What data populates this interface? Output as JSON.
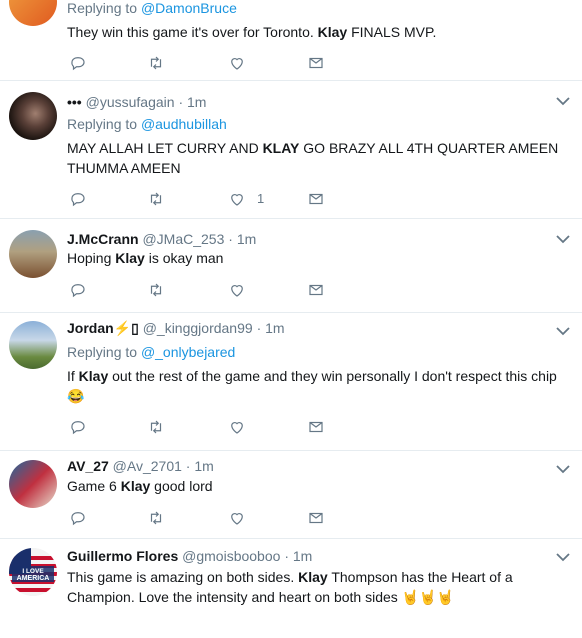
{
  "tweets": [
    {
      "reply_prefix": "Replying to ",
      "reply_handle": "@DamonBruce",
      "text_before": "They win this game it's over for Toronto. ",
      "bold": "Klay",
      "text_after": " FINALS MVP."
    },
    {
      "name": "•••",
      "handle": "@yussufagain",
      "dot": "·",
      "time": "1m",
      "reply_prefix": "Replying to ",
      "reply_handle": "@audhubillah",
      "text_before": "MAY ALLAH LET CURRY AND ",
      "bold": "KLAY",
      "text_after": " GO BRAZY ALL 4TH QUARTER AMEEN THUMMA AMEEN",
      "like_count": "1"
    },
    {
      "name": "J.McCrann",
      "handle": "@JMaC_253",
      "dot": "·",
      "time": "1m",
      "text_before": "Hoping ",
      "bold": "Klay",
      "text_after": " is okay man"
    },
    {
      "name": "Jordan⚡▯",
      "handle": "@_kinggjordan99",
      "dot": "·",
      "time": "1m",
      "reply_prefix": "Replying to ",
      "reply_handle": "@_onlybejared",
      "text_before": "If ",
      "bold": "Klay",
      "text_after": " out the rest of the game and they win personally I don't respect this chip",
      "emoji": "😂"
    },
    {
      "name": "AV_27",
      "handle": "@Av_2701",
      "dot": "·",
      "time": "1m",
      "text_before": "Game 6 ",
      "bold": "Klay",
      "text_after": " good lord"
    },
    {
      "name": "Guillermo Flores",
      "handle": "@gmoisbooboo",
      "dot": "·",
      "time": "1m",
      "avatar_text": "I LOVE AMERICA",
      "text_before": "This game is amazing on both sides. ",
      "bold": "Klay",
      "text_after": " Thompson has the Heart of a Champion. Love the intensity and heart on both sides",
      "emoji": "🤘🤘🤘"
    }
  ],
  "colors": {
    "link": "#1b95e0",
    "muted": "#657786",
    "border": "#e6ecf0",
    "icon": "#657786"
  },
  "icons": [
    "reply-icon",
    "retweet-icon",
    "like-icon",
    "message-icon",
    "chevron-down-icon"
  ]
}
